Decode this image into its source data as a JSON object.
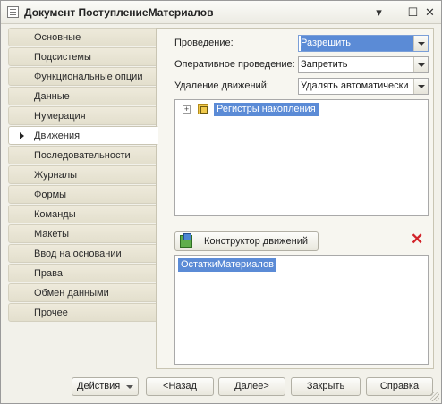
{
  "window": {
    "title": "Документ ПоступлениеМатериалов",
    "controls": {
      "menu_glyph": "▾",
      "minimize_glyph": "—",
      "maximize_glyph": "☐",
      "close_glyph": "✕"
    }
  },
  "sidebar": {
    "active_index": 5,
    "items": [
      {
        "label": "Основные"
      },
      {
        "label": "Подсистемы"
      },
      {
        "label": "Функциональные опции"
      },
      {
        "label": "Данные"
      },
      {
        "label": "Нумерация"
      },
      {
        "label": "Движения"
      },
      {
        "label": "Последовательности"
      },
      {
        "label": "Журналы"
      },
      {
        "label": "Формы"
      },
      {
        "label": "Команды"
      },
      {
        "label": "Макеты"
      },
      {
        "label": "Ввод на основании"
      },
      {
        "label": "Права"
      },
      {
        "label": "Обмен данными"
      },
      {
        "label": "Прочее"
      }
    ]
  },
  "movements": {
    "posting": {
      "label": "Проведение:",
      "value": "Разрешить"
    },
    "realtime_posting": {
      "label": "Оперативное проведение:",
      "value": "Запретить"
    },
    "delete_movements": {
      "label": "Удаление движений:",
      "value": "Удалять автоматически"
    },
    "tree": {
      "expand_glyph": "+",
      "root_label": "Регистры накопления"
    },
    "constructor_button": "Конструктор движений",
    "delete_glyph": "✕",
    "registers": [
      "ОстаткиМатериалов"
    ]
  },
  "footer": {
    "actions": "Действия",
    "back": "<Назад",
    "next": "Далее>",
    "close": "Закрыть",
    "help": "Справка"
  },
  "colors": {
    "selection": "#5b8bd6",
    "delete_icon": "#d2232a",
    "window_bg": "#f2f1ea"
  }
}
